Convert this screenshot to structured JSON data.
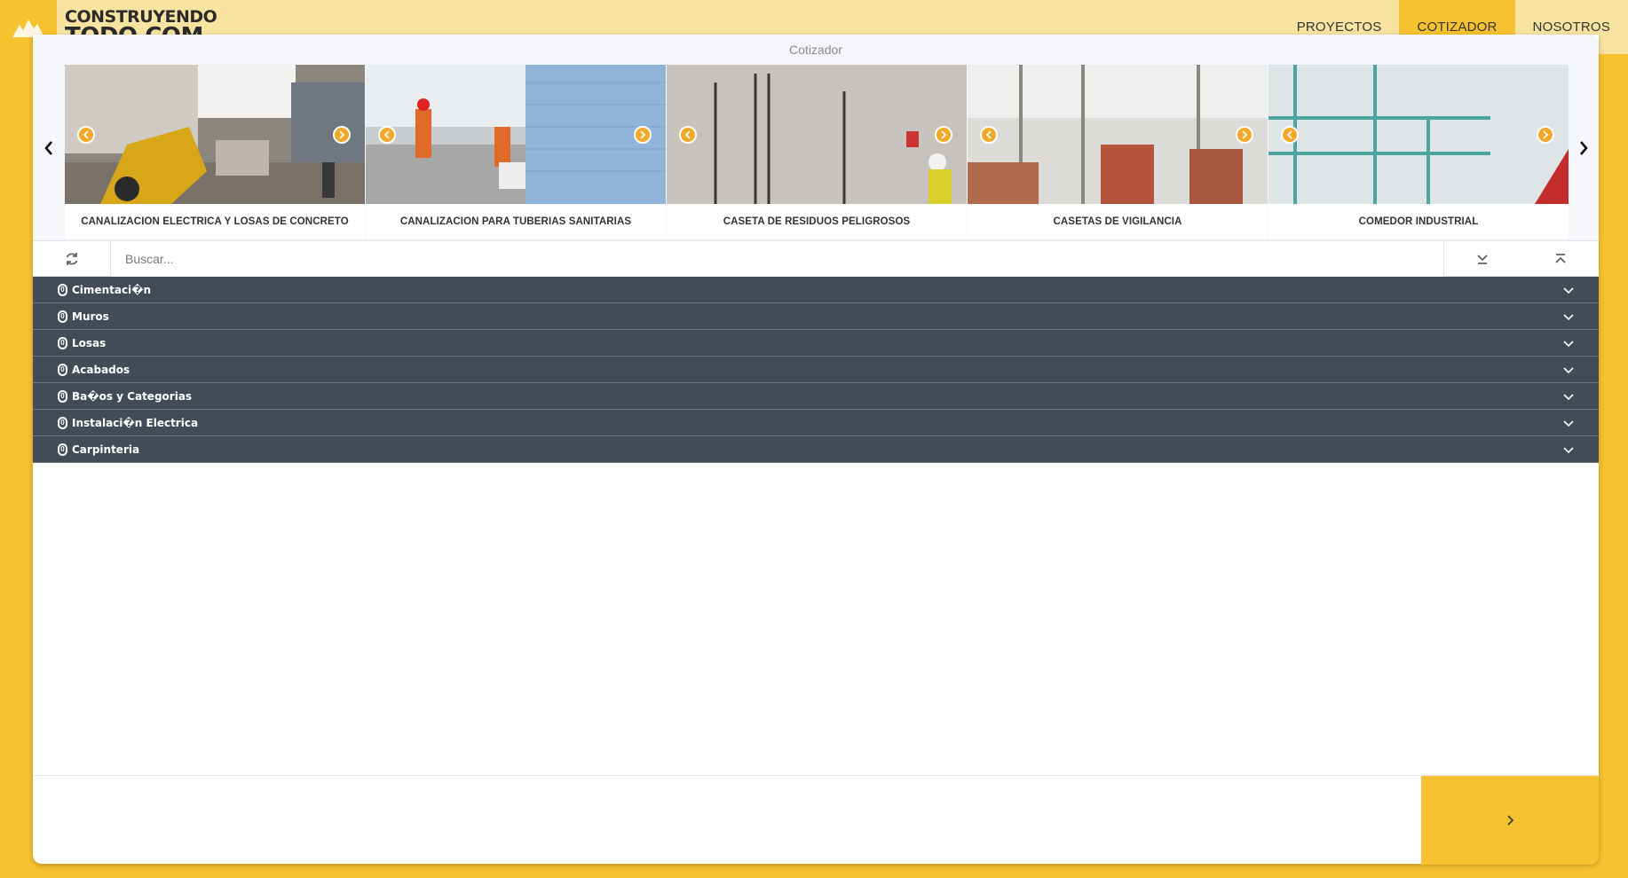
{
  "brand": {
    "line1": "CONSTRUYENDO",
    "line2": "TODO.COM",
    "logo_icon": "mountains-icon"
  },
  "nav": {
    "items": [
      {
        "label": "PROYECTOS",
        "active": false
      },
      {
        "label": "COTIZADOR",
        "active": true
      },
      {
        "label": "NOSOTROS",
        "active": false
      }
    ]
  },
  "card": {
    "title": "Cotizador"
  },
  "carousel": {
    "prev_icon": "chevron-left-icon",
    "next_icon": "chevron-right-icon",
    "slides": [
      {
        "label": "CANALIZACION ELECTRICA Y LOSAS DE CONCRETO"
      },
      {
        "label": "CANALIZACION PARA TUBERIAS SANITARIAS"
      },
      {
        "label": "CASETA DE RESIDUOS PELIGROSOS"
      },
      {
        "label": "CASETAS DE VIGILANCIA"
      },
      {
        "label": "COMEDOR INDUSTRIAL"
      }
    ]
  },
  "search": {
    "placeholder": "Buscar...",
    "value": ""
  },
  "categories": [
    {
      "badge": "0",
      "label": "Cimentaci�n"
    },
    {
      "badge": "0",
      "label": "Muros"
    },
    {
      "badge": "0",
      "label": "Losas"
    },
    {
      "badge": "0",
      "label": "Acabados"
    },
    {
      "badge": "0",
      "label": "Ba�os y Categorias"
    },
    {
      "badge": "0",
      "label": "Instalaci�n Electrica"
    },
    {
      "badge": "0",
      "label": "Carpinteria"
    }
  ],
  "colors": {
    "accent": "#f6c230",
    "topbar": "#f8e3a0",
    "accordion": "#434c56"
  }
}
